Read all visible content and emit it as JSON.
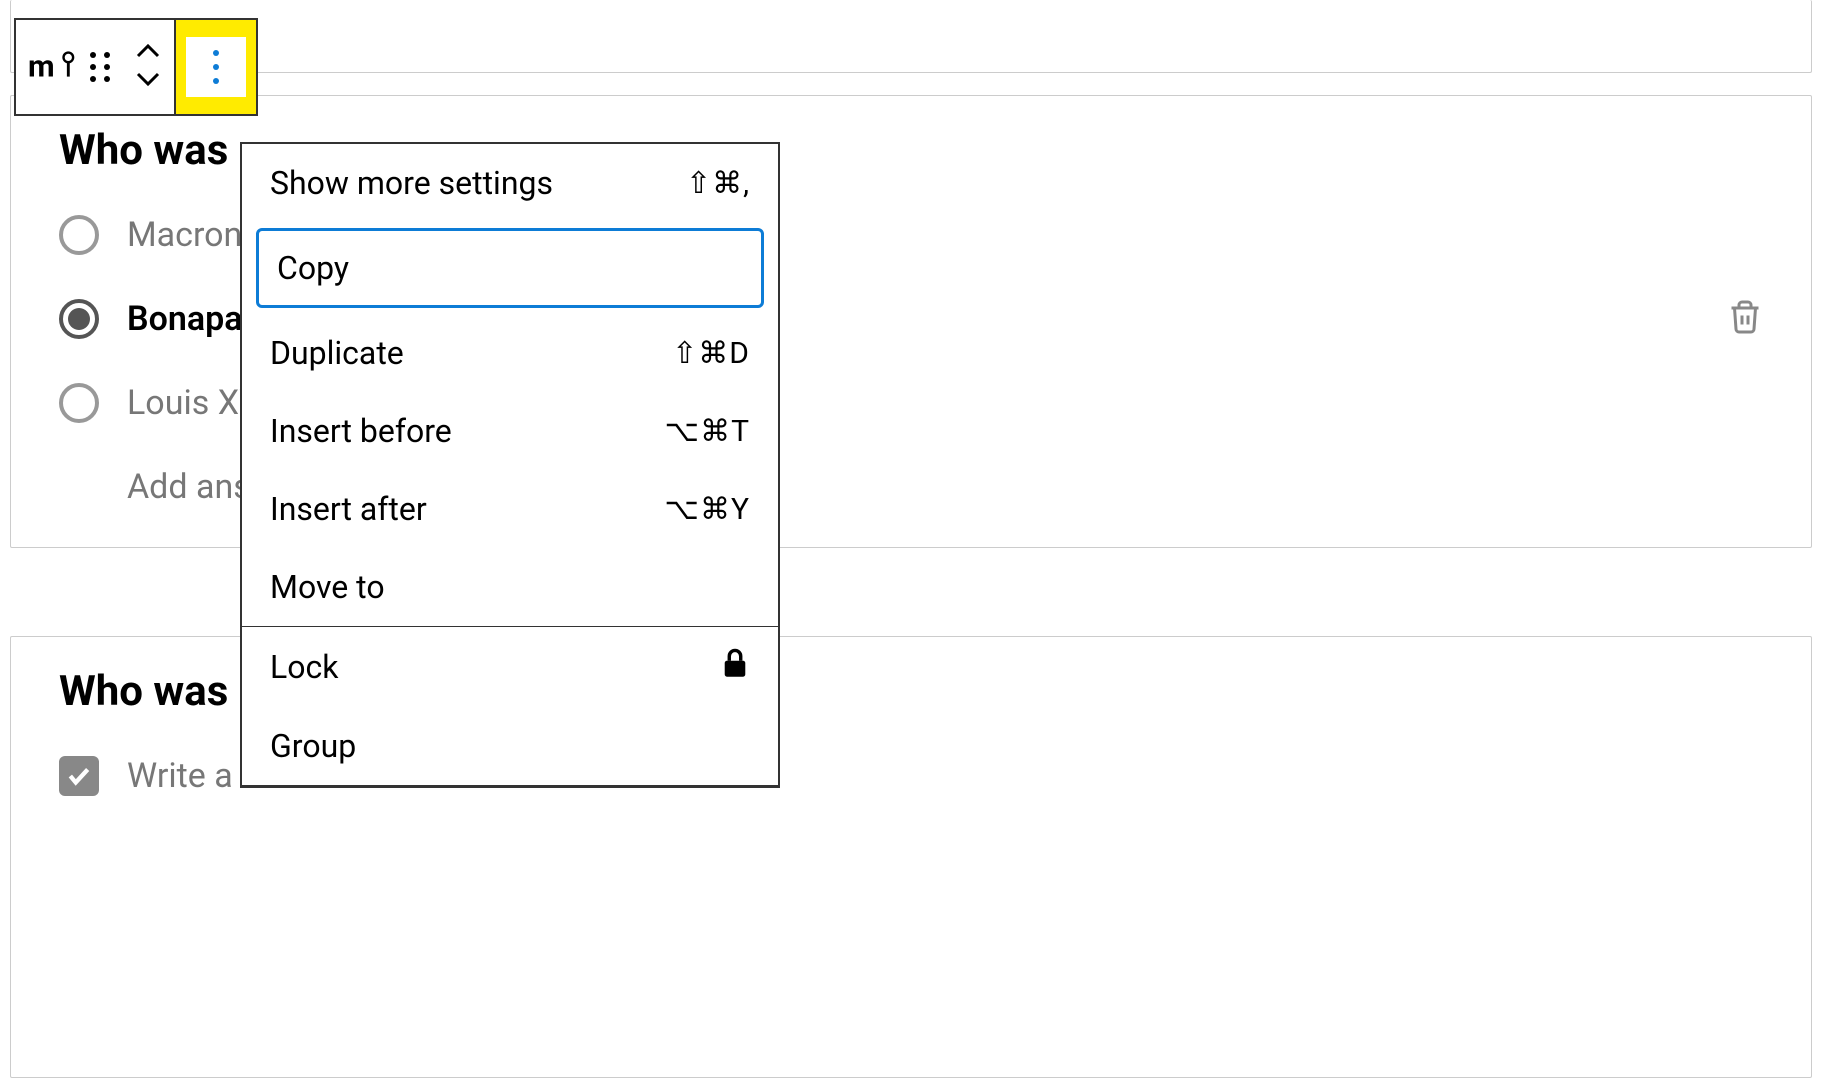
{
  "toolbar": {
    "block_type": "mi"
  },
  "block2": {
    "title": "Who was",
    "options": [
      {
        "label": "Macron",
        "selected": false
      },
      {
        "label": "Bonaparte",
        "selected": true
      },
      {
        "label": "Louis XVI",
        "selected": false
      }
    ],
    "add_answer": "Add answer"
  },
  "block3": {
    "title": "Who was",
    "option1": "Write a"
  },
  "menu": {
    "items": [
      {
        "label": "Show more settings",
        "shortcut": "⇧⌘,"
      },
      {
        "label": "Copy",
        "shortcut": ""
      },
      {
        "label": "Duplicate",
        "shortcut": "⇧⌘D"
      },
      {
        "label": "Insert before",
        "shortcut": "⌥⌘T"
      },
      {
        "label": "Insert after",
        "shortcut": "⌥⌘Y"
      },
      {
        "label": "Move to",
        "shortcut": ""
      },
      {
        "label": "Lock",
        "shortcut": ""
      },
      {
        "label": "Group",
        "shortcut": ""
      }
    ]
  }
}
